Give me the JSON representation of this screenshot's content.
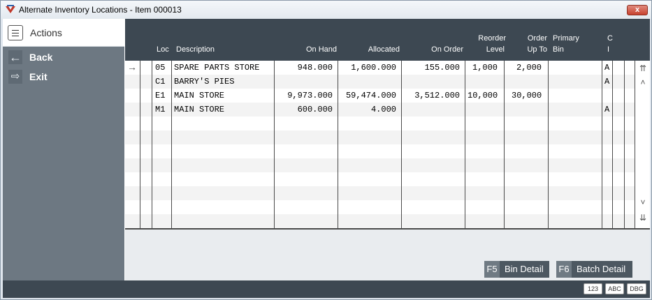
{
  "window": {
    "title": "Alternate Inventory Locations - Item 000013",
    "close_label": "x"
  },
  "sidebar": {
    "header": "Actions",
    "items": [
      {
        "label": "Back",
        "icon": "back-arrow-icon"
      },
      {
        "label": "Exit",
        "icon": "exit-icon"
      }
    ]
  },
  "grid": {
    "columns": {
      "loc": "Loc",
      "description": "Description",
      "on_hand": "On Hand",
      "allocated": "Allocated",
      "on_order": "On Order",
      "reorder_level_1": "Reorder",
      "reorder_level_2": "Level",
      "order_up_to_1": "Order",
      "order_up_to_2": "Up To",
      "primary_bin_1": "Primary",
      "primary_bin_2": "Bin",
      "ci_1": "C",
      "ci_2": "I"
    },
    "rows": [
      {
        "loc": "05",
        "description": "SPARE PARTS STORE",
        "on_hand": "948.000",
        "allocated": "1,600.000",
        "on_order": "155.000",
        "reorder_level": "1,000",
        "order_up_to": "2,000",
        "primary_bin": "",
        "ci": "A"
      },
      {
        "loc": "C1",
        "description": "BARRY'S PIES",
        "on_hand": "",
        "allocated": "",
        "on_order": "",
        "reorder_level": "",
        "order_up_to": "",
        "primary_bin": "",
        "ci": "A"
      },
      {
        "loc": "E1",
        "description": "MAIN STORE",
        "on_hand": "9,973.000",
        "allocated": "59,474.000",
        "on_order": "3,512.000",
        "reorder_level": "10,000",
        "order_up_to": "30,000",
        "primary_bin": "",
        "ci": ""
      },
      {
        "loc": "M1",
        "description": "MAIN STORE",
        "on_hand": "600.000",
        "allocated": "4.000",
        "on_order": "",
        "reorder_level": "",
        "order_up_to": "",
        "primary_bin": "",
        "ci": "A"
      }
    ]
  },
  "buttons": {
    "bin_detail_key": "F5",
    "bin_detail_label": "Bin Detail",
    "batch_detail_key": "F6",
    "batch_detail_label": "Batch Detail"
  },
  "statusbar": {
    "chips": [
      "123",
      "ABC",
      "DBG"
    ]
  },
  "colors": {
    "header_bg": "#3d4852",
    "sidebar_bg": "#6d7882",
    "close_red": "#c7422f"
  }
}
